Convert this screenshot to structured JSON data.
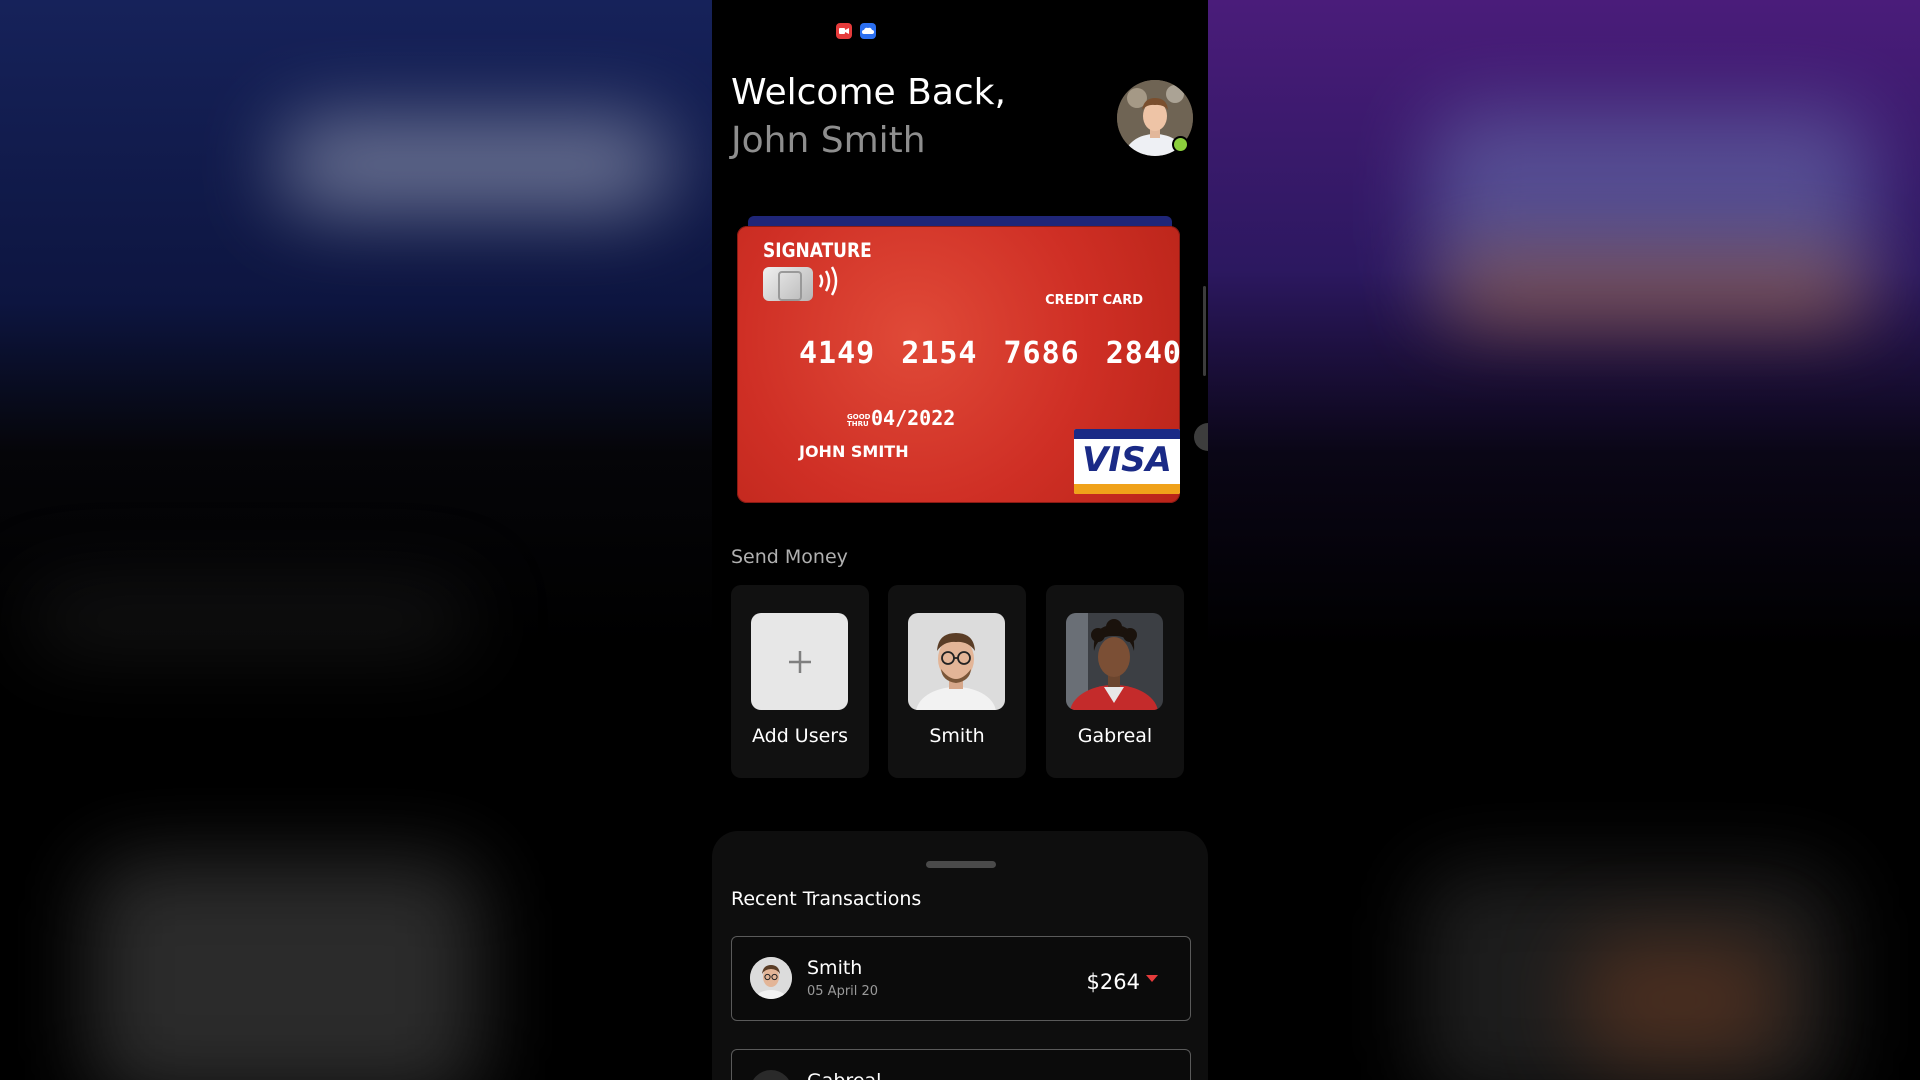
{
  "header": {
    "welcome": "Welcome Back,",
    "user_name": "John Smith",
    "status_icons": [
      "screen-record-icon",
      "cloud-app-icon"
    ],
    "online_color": "#8bcf3c"
  },
  "card": {
    "signature": "SIGNATURE",
    "type": "CREDIT CARD",
    "number_groups": [
      "4149",
      "2154",
      "7686",
      "2840"
    ],
    "good_thru_label": "GOOD THRU",
    "expiry": "04/2022",
    "holder": "JOHN SMITH",
    "brand": "VISA",
    "color": "#d0322a"
  },
  "send_money": {
    "title": "Send Money",
    "add_label": "Add Users",
    "contacts": [
      {
        "name": "Smith"
      },
      {
        "name": "Gabreal"
      }
    ]
  },
  "transactions": {
    "title": "Recent Transactions",
    "items": [
      {
        "name": "Smith",
        "date": "05 April 20",
        "amount": "$264"
      },
      {
        "name": "Gabreal",
        "date": "",
        "amount": ""
      }
    ]
  }
}
